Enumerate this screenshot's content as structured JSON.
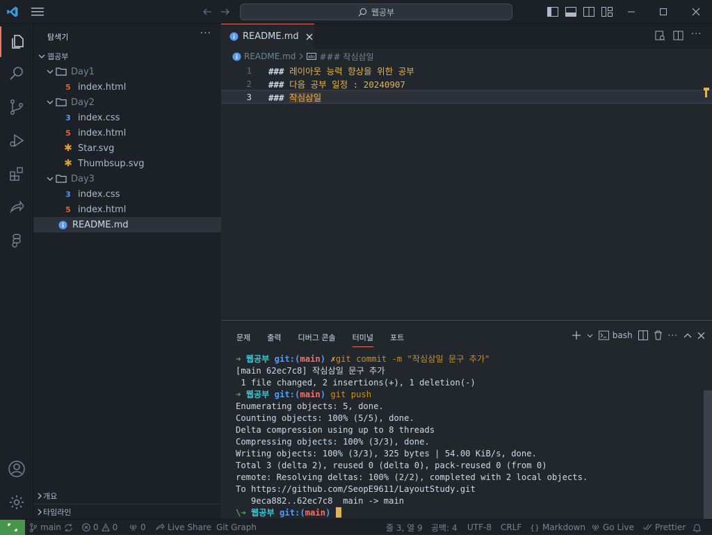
{
  "titlebar": {
    "search_text": "웹공부"
  },
  "sidebar": {
    "title": "탐색기",
    "more": "···",
    "root": "웹공부",
    "items": [
      {
        "label": "Day1",
        "type": "folder"
      },
      {
        "label": "index.html",
        "type": "html"
      },
      {
        "label": "Day2",
        "type": "folder"
      },
      {
        "label": "index.css",
        "type": "css"
      },
      {
        "label": "index.html",
        "type": "html"
      },
      {
        "label": "Star.svg",
        "type": "svg"
      },
      {
        "label": "Thumbsup.svg",
        "type": "svg"
      },
      {
        "label": "Day3",
        "type": "folder"
      },
      {
        "label": "index.css",
        "type": "css"
      },
      {
        "label": "index.html",
        "type": "html"
      },
      {
        "label": "README.md",
        "type": "info"
      }
    ],
    "outline_label": "개요",
    "timeline_label": "타임라인"
  },
  "editor": {
    "tab_label": "README.md",
    "breadcrumb_file": "README.md",
    "breadcrumb_symbol": "### 작심삼일",
    "lines": [
      {
        "num": "1",
        "hash": "###",
        "text": "레이아웃 능력 향상을 위한 공부"
      },
      {
        "num": "2",
        "hash": "###",
        "text": "다음 공부 일정 : 20240907"
      },
      {
        "num": "3",
        "hash": "###",
        "text": "작심삼일"
      }
    ]
  },
  "panel": {
    "tabs": [
      "문제",
      "출력",
      "디버그 콘솔",
      "터미널",
      "포트"
    ],
    "active_tab": "터미널",
    "shell": "bash",
    "prompt_dir": "웹공부",
    "prompt_git": "git:(",
    "prompt_branch": "main",
    "prompt_close": ")",
    "commit_cmd": "git commit -m \"작심삼일 문구 추가\"",
    "out1": "[main 62ec7c8] 작심삼일 문구 추가",
    "out2": " 1 file changed, 2 insertions(+), 1 deletion(-)",
    "push_cmd": "git push",
    "push_out": [
      "Enumerating objects: 5, done.",
      "Counting objects: 100% (5/5), done.",
      "Delta compression using up to 8 threads",
      "Compressing objects: 100% (3/3), done.",
      "Writing objects: 100% (3/3), 325 bytes | 54.00 KiB/s, done.",
      "Total 3 (delta 2), reused 0 (delta 0), pack-reused 0 (from 0)",
      "remote: Resolving deltas: 100% (2/2), completed with 2 local objects.",
      "To https://github.com/SeopE9611/LayoutStudy.git",
      "   9eca882..62ec7c8  main -> main"
    ],
    "last_prefix": "\\➜"
  },
  "status": {
    "branch": "main",
    "errors": "0",
    "warnings": "0",
    "ports": "0",
    "live_share": "Live Share",
    "git_graph": "Git Graph",
    "position": "줄 3, 열 9",
    "spaces": "공백: 4",
    "encoding": "UTF-8",
    "eol": "CRLF",
    "language": "Markdown",
    "go_live": "Go Live",
    "prettier": "Prettier"
  },
  "colors": {
    "accent": "#ec775c",
    "remote": "#46954a",
    "html": "#e8613a",
    "css": "#539bf5",
    "svg": "#e0a030",
    "info": "#539bf5"
  }
}
